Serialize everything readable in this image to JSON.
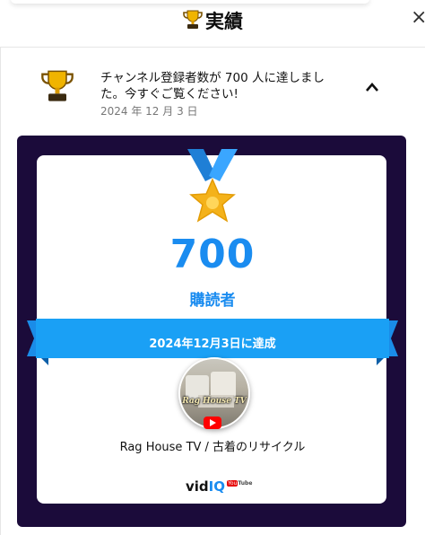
{
  "header": {
    "title": "実績",
    "close_label": "×"
  },
  "notification": {
    "message": "チャンネル登録者数が 700 人に達しました。今すぐご覧ください!",
    "date": "2024 年 12 月 3 日",
    "chevron": "^"
  },
  "achievement": {
    "count": "700",
    "unit_label": "購読者",
    "ribbon_text": "2024年12月3日に達成",
    "avatar_text": "Rag House TV",
    "channel_name": "Rag House TV / 古着のリサイクル"
  },
  "branding": {
    "vid": "vid",
    "iq": "IQ",
    "you": "You",
    "tube": "Tube"
  },
  "colors": {
    "accent": "#1a8cf0",
    "ribbon": "#1aa0f5",
    "frame": "#1b0b3a",
    "medal": "#f4b21a"
  },
  "icons": [
    "trophy-icon",
    "close-icon",
    "chevron-up-icon",
    "medal-icon",
    "youtube-icon"
  ]
}
